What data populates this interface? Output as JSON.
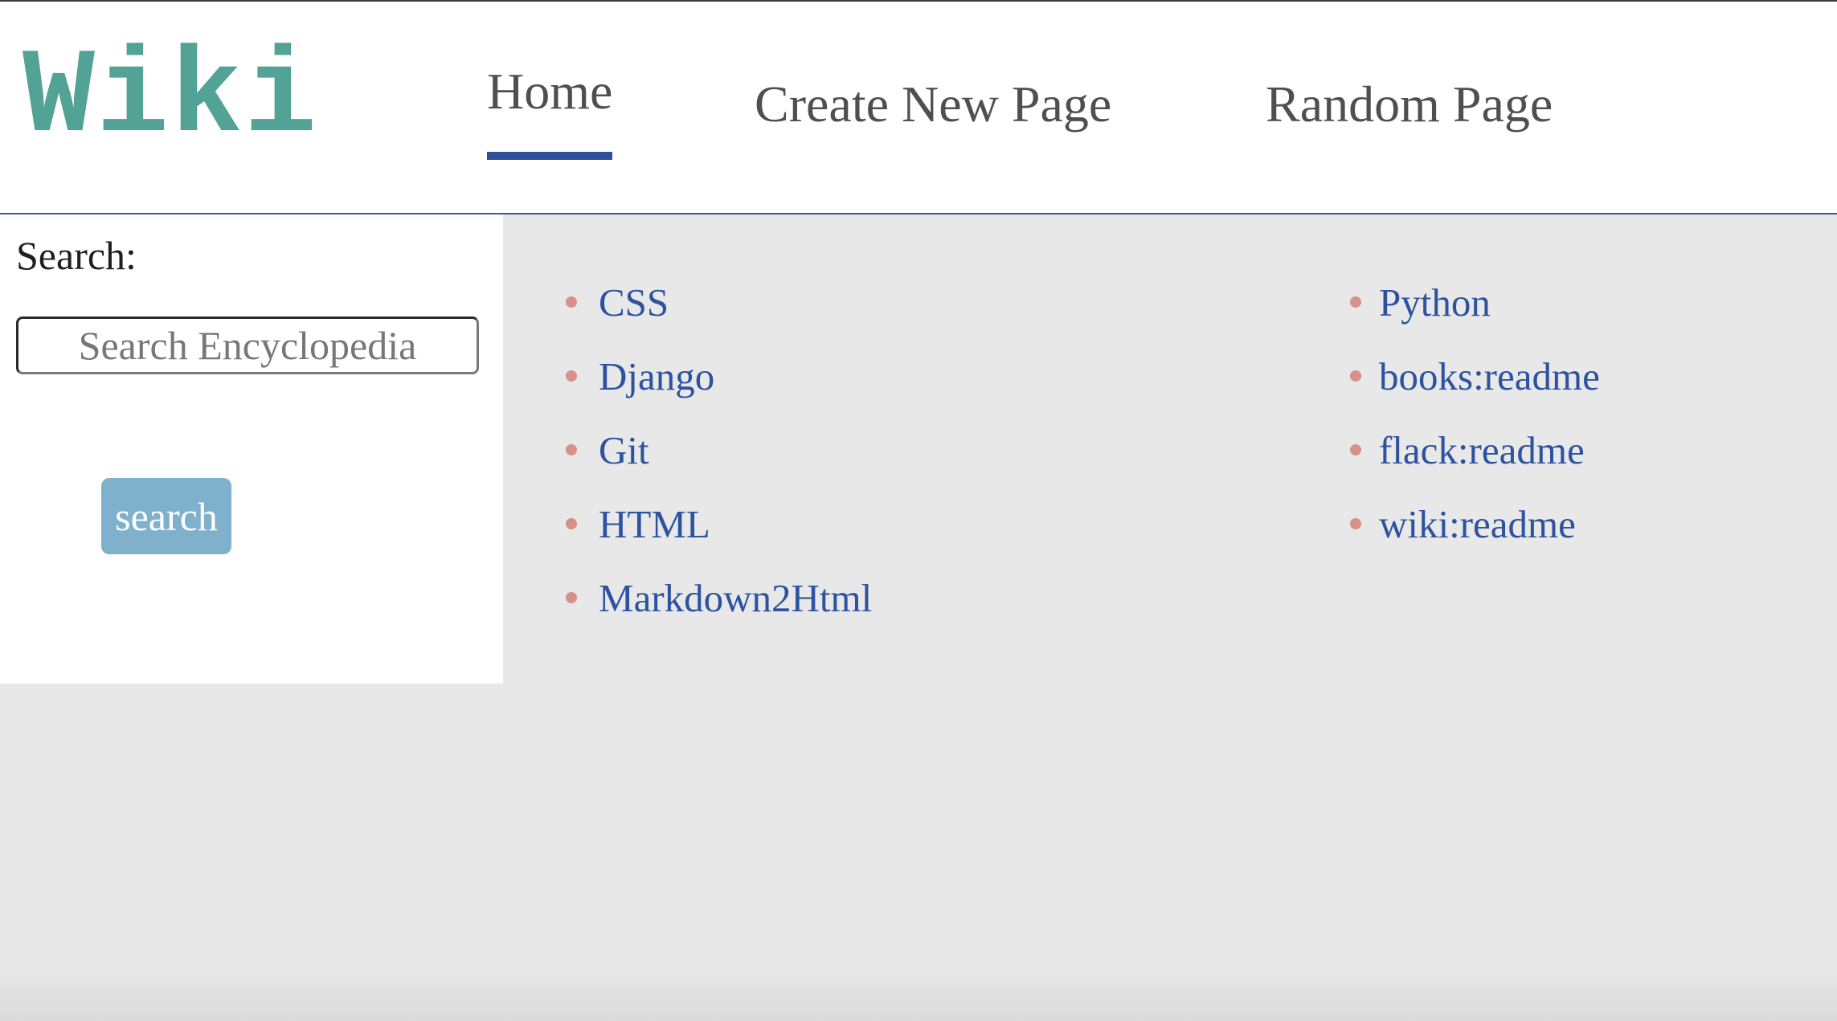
{
  "header": {
    "logo_text": "Wiki",
    "nav": [
      {
        "label": "Home",
        "active": true
      },
      {
        "label": "Create New Page",
        "active": false
      },
      {
        "label": "Random Page",
        "active": false
      }
    ]
  },
  "sidebar": {
    "search_label": "Search:",
    "search_input": {
      "value": "",
      "placeholder": "Search Encyclopedia"
    },
    "search_button_label": "search"
  },
  "entries": {
    "left_column": [
      "CSS",
      "Django",
      "Git",
      "HTML",
      "Markdown2Html"
    ],
    "right_column": [
      "Python",
      "books:readme",
      "flack:readme",
      "wiki:readme"
    ]
  },
  "colors": {
    "logo": "#52a295",
    "nav_active_underline": "#2f4f9b",
    "header_border": "#3b5a9e",
    "link": "#2c52a0",
    "bullet": "#d4928a",
    "search_button": "#7fb0cc",
    "background": "#e8e8e8"
  }
}
